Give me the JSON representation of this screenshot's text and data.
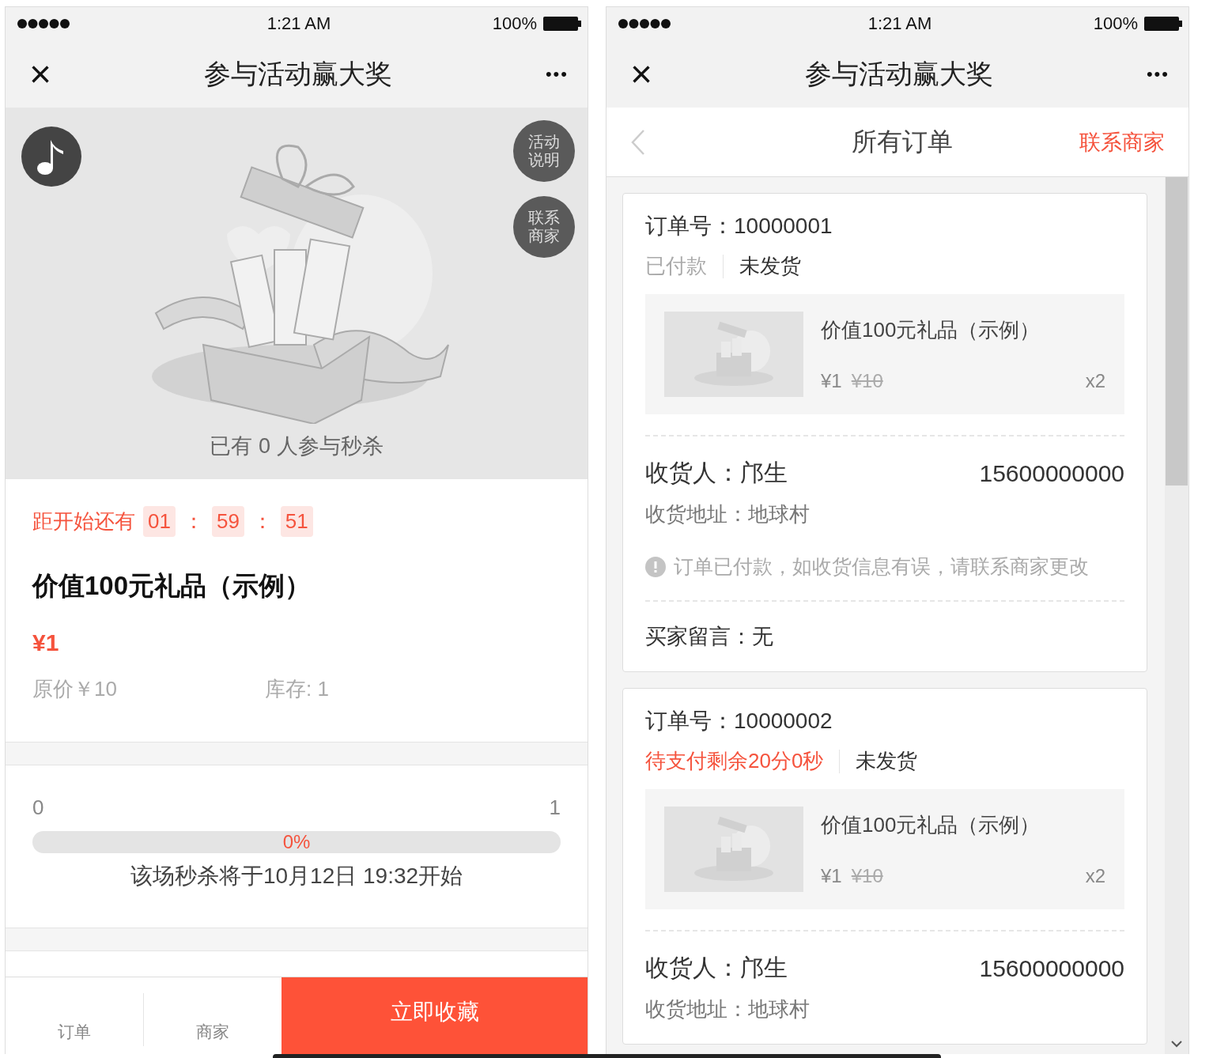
{
  "screens": [
    {
      "status_bar": {
        "time": "1:21 AM",
        "battery": "100%"
      },
      "nav": {
        "close": "×",
        "title": "参与活动赢大奖",
        "more": "•••"
      },
      "hero": {
        "side_buttons": [
          "活动说明",
          "联系商家"
        ],
        "participants": "已有 0 人参与秒杀"
      },
      "countdown": {
        "label": "距开始还有",
        "separator": "：",
        "segments": [
          "01",
          "59",
          "51"
        ]
      },
      "product": {
        "name": "价值100元礼品（示例）",
        "price": "¥1",
        "original_price": "原价￥10",
        "stock": "库存: 1"
      },
      "progress": {
        "min": "0",
        "max": "1",
        "level": 0,
        "percent": "0%",
        "note": "该场秒杀将于10月12日 19:32开始"
      },
      "bottom_bar": {
        "tabs": [
          "订单",
          "商家"
        ],
        "action": "立即收藏"
      }
    },
    {
      "status_bar": {
        "time": "1:21 AM",
        "battery": "100%"
      },
      "nav": {
        "close": "×",
        "title": "参与活动赢大奖",
        "more": "•••"
      },
      "subheader": {
        "title": "所有订单",
        "action": "联系商家"
      },
      "orders": [
        {
          "number": "订单号：10000001",
          "pay_status": {
            "kind": "paid",
            "text": "已付款"
          },
          "ship_status": "未发货",
          "item": {
            "name": "价值100元礼品（示例）",
            "price": "¥1",
            "old_price": "¥10",
            "qty": "x2"
          },
          "receiver": "收货人：邝生",
          "phone": "15600000000",
          "address": "收货地址：地球村",
          "notice": "订单已付款，如收货信息有误，请联系商家更改",
          "message": "买家留言：无"
        },
        {
          "number": "订单号：10000002",
          "pay_status": {
            "kind": "pending",
            "text": "待支付剩余20分0秒"
          },
          "ship_status": "未发货",
          "item": {
            "name": "价值100元礼品（示例）",
            "price": "¥1",
            "old_price": "¥10",
            "qty": "x2"
          },
          "receiver": "收货人：邝生",
          "phone": "15600000000",
          "address": "收货地址：地球村"
        }
      ]
    }
  ]
}
